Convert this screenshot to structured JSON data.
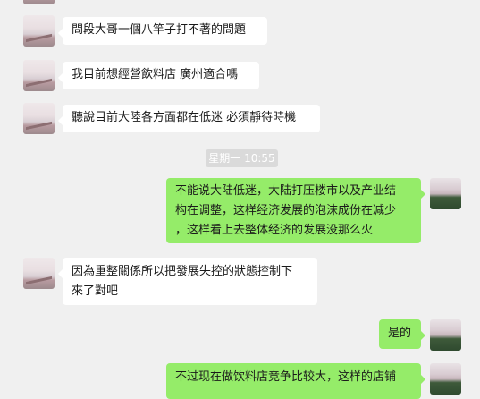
{
  "messages": [
    {
      "side": "left",
      "lines": [
        "問段大哥一個八竿子打不著的問題"
      ]
    },
    {
      "side": "left",
      "lines": [
        "我目前想經營飲料店 廣州適合嗎"
      ]
    },
    {
      "side": "left",
      "lines": [
        "聽說目前大陸各方面都在低迷 必須靜待時機"
      ]
    },
    {
      "side": "right",
      "lines": [
        "不能说大陆低迷，大陆打压楼市以及产业结",
        "构在调整，这样经济发展的泡沫成份在减少",
        "，这样看上去整体经济的发展没那么火"
      ]
    },
    {
      "side": "left",
      "lines": [
        "因為重整關係所以把發展失控的狀態控制下",
        "來了對吧"
      ]
    },
    {
      "side": "right",
      "lines": [
        "是的"
      ]
    },
    {
      "side": "right",
      "lines": [
        "不过现在做饮料店竞争比较大，这样的店铺"
      ]
    }
  ],
  "timestamp": "星期一 10:55"
}
